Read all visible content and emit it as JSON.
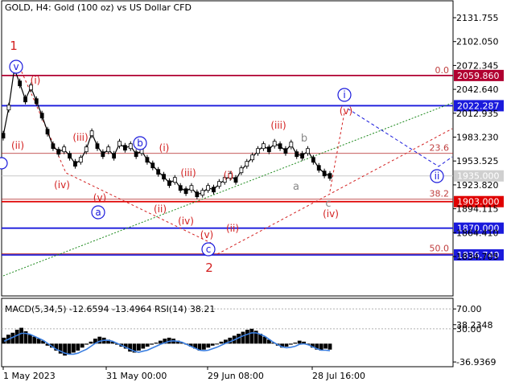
{
  "header": {
    "title": "GOLD, H4:  Gold (100 oz) vs US Dollar CFD"
  },
  "colors": {
    "red": "#d32020",
    "blue": "#1a1adc",
    "navy": "#000080",
    "green": "#1d8a1d",
    "gray": "#888888",
    "dim": "#555555"
  },
  "chart_data": [
    {
      "type": "line",
      "name": "price",
      "ylim": [
        1820,
        2150
      ],
      "y_ticks": [
        "2131.755",
        "2102.050",
        "2072.345",
        "2042.640",
        "2012.935",
        "1983.230",
        "1953.525",
        "1923.820",
        "1894.115",
        "1864.410",
        "1834.705"
      ],
      "x_tick_labels": [
        "1 May 2023",
        "31 May 00:00",
        "29 Jun 08:00",
        "28 Jul 16:00"
      ],
      "close_points": [
        1985,
        2020,
        2068,
        2050,
        2030,
        2045,
        2028,
        2010,
        1990,
        1972,
        1965,
        1968,
        1960,
        1950,
        1955,
        1968,
        1988,
        1972,
        1962,
        1968,
        1960,
        1975,
        1970,
        1972,
        1962,
        1966,
        1955,
        1948,
        1940,
        1934,
        1926,
        1930,
        1920,
        1916,
        1920,
        1912,
        1914,
        1920,
        1918,
        1925,
        1930,
        1935,
        1930,
        1942,
        1950,
        1958,
        1966,
        1972,
        1968,
        1975,
        1972,
        1966,
        1974,
        1962,
        1960,
        1966,
        1955,
        1945,
        1938,
        1935
      ],
      "price_levels": [
        {
          "label": "2059.860",
          "value": 2059.86,
          "color": "#b00030"
        },
        {
          "label": "2022.287",
          "value": 2022.287,
          "color": "#1a1adc"
        },
        {
          "label": "1903.000",
          "value": 1903.0,
          "color": "#e00000"
        },
        {
          "label": "1870.000",
          "value": 1870.0,
          "color": "#1a1adc"
        },
        {
          "label": "1836.740",
          "value": 1836.74,
          "color": "#1a1adc"
        }
      ],
      "current_price": "1935.000",
      "fib_levels": [
        {
          "label": "0.0",
          "value": 2059.86
        },
        {
          "label": "23.6",
          "value": 1963.0
        },
        {
          "label": "38.2",
          "value": 1906.0
        },
        {
          "label": "50.0",
          "value": 1838.0
        }
      ],
      "wave_labels": {
        "major": [
          "1",
          "2"
        ],
        "circled": [
          "v",
          "a",
          "b",
          "c",
          "i",
          "ii"
        ],
        "minor": [
          "(i)",
          "(ii)",
          "(iii)",
          "(iv)",
          "(v)",
          "(i)",
          "(ii)",
          "(iii)",
          "(iv)",
          "(v)",
          "(i)",
          "(ii)",
          "(iii)",
          "(iv)",
          "(v)"
        ],
        "gray": [
          "a",
          "b",
          "c"
        ]
      }
    },
    {
      "type": "bar",
      "name": "indicator",
      "title": "MACD(5,34,5) -12.6594 -13.4964 RSI(14) 38.21",
      "ylim": [
        -40,
        80
      ],
      "y_ticks": [
        "38.2348",
        "70.00",
        "30.00",
        "-36.9369"
      ],
      "macd_values": [
        12,
        18,
        22,
        28,
        32,
        25,
        18,
        14,
        10,
        6,
        -4,
        -8,
        -14,
        -20,
        -24,
        -22,
        -18,
        -14,
        -8,
        -2,
        4,
        10,
        14,
        12,
        8,
        4,
        -2,
        -6,
        -10,
        -16,
        -18,
        -14,
        -10,
        -6,
        -2,
        2,
        6,
        10,
        12,
        10,
        6,
        2,
        -2,
        -6,
        -10,
        -14,
        -12,
        -8,
        -4,
        0,
        4,
        8,
        12,
        16,
        20,
        24,
        28,
        30,
        26,
        20,
        14,
        8,
        2,
        -4,
        -8,
        -6,
        -2,
        2,
        6,
        4,
        -2,
        -8,
        -12,
        -14,
        -10,
        -12
      ],
      "signal_values": [
        8,
        12,
        16,
        20,
        24,
        24,
        22,
        18,
        14,
        10,
        4,
        -2,
        -8,
        -12,
        -16,
        -18,
        -18,
        -16,
        -12,
        -8,
        -2,
        4,
        8,
        10,
        10,
        8,
        4,
        0,
        -4,
        -8,
        -12,
        -14,
        -12,
        -10,
        -6,
        -2,
        2,
        5,
        8,
        9,
        8,
        6,
        2,
        -2,
        -6,
        -10,
        -11,
        -10,
        -7,
        -4,
        0,
        4,
        7,
        11,
        15,
        19,
        22,
        25,
        25,
        22,
        18,
        12,
        6,
        1,
        -3,
        -5,
        -4,
        -2,
        2,
        3,
        1,
        -3,
        -7,
        -10,
        -10,
        -11
      ]
    }
  ]
}
